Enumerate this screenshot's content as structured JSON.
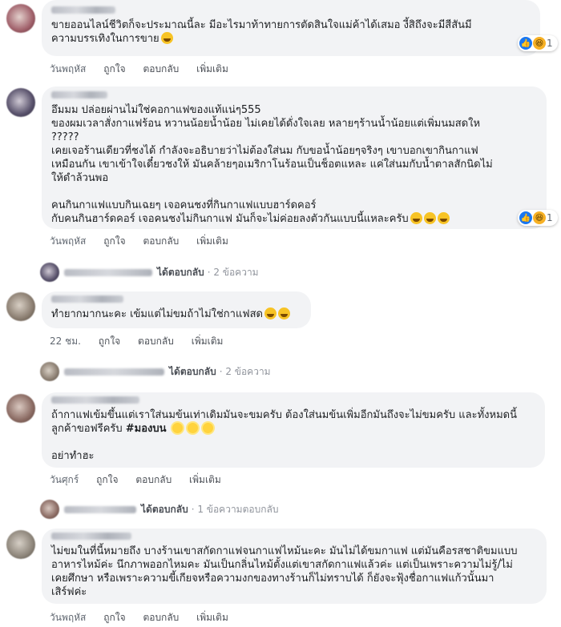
{
  "actions": {
    "day1": "วันพฤหัส",
    "day2": "วันพฤหัส",
    "day3": "22 ชม.",
    "day4": "วันศุกร์",
    "day5": "วันพฤหัส",
    "like": "ถูกใจ",
    "reply": "ตอบกลับ",
    "more": "เพิ่มเติม"
  },
  "reply_label": "ได้ตอบกลับ",
  "reply_count_2": "· 2 ข้อความ",
  "reply_count_1": "· 1 ข้อความตอบกลับ",
  "reactions": {
    "count_1": "1",
    "count_2": "1"
  },
  "comments": [
    {
      "lines": [
        "ขายออนไลน์ชีวิตก็จะประมาณนี้ละ มีอะไรมาท้าทายการตัดสินใจแม่ค้าได้เสมอ งี้สิถึงจะมีสีสันมี",
        "ความบรรเทิงในการขาย"
      ]
    },
    {
      "lines": [
        "อึมมม ปล่อยผ่านไม่ใช่คอกาแฟของแท้แน่ๆ555",
        " ของผมเวลาสั่งกาแฟร้อน หวานน้อยน้ำน้อย ไม่เคยได้ดั่งใจเลย หลายๆร้านน้ำน้อยแต่เพิ่มนมสดให",
        "?????",
        "เคยเจอร้านเดียวที่ชงได้ กำลังจะอธิบายว่าไม่ต้องใส่นม กับขอน้ำน้อยๆจริงๆ เขาบอกเขากินกาแฟ",
        "เหมือนกัน เขาเข้าใจเดี๋ยวชงให้ มันคล้ายๆอเมริกาโนร้อนเป็นช็อตแหละ แค่ใส่นมกับน้ำตาลสักนิดไม่",
        "ให้ดำล้วนพอ",
        "",
        "คนกินกาแฟแบบกินเฉยๆ เจอคนชงที่กินกาแฟแบบฮาร์ดคอร์",
        "กับคนกินฮาร์ดคอร์ เจอคนชงไม่กินกาแฟ มันก็จะไม่ค่อยลงตัวกันแบบนี้แหละครับ"
      ]
    },
    {
      "lines": [
        "ทำยากมากนะคะ เข้มแต่ไม่ขมถ้าไม่ใช่กาแฟสด"
      ]
    },
    {
      "lines": [
        "ถ้ากาแฟเข้มขึ้นแต่เราใส่นมข้นเท่าเดิมมันจะขมครับ ต้องใส่นมข้นเพิ่มอีกมันถึงจะไม่ขมครับ และทั้งหมดนี้",
        "ลูกค้าขอฟรีครับ "
      ],
      "hashtag": "#มองบน",
      "tail": "อย่าทำฮะ"
    },
    {
      "lines": [
        "ไม่ขมในที่นี้หมายถึง บางร้านเขาสกัดกาแฟจนกาแฟไหม้นะคะ มันไม่ได้ขมกาแฟ แต่มันคือรสชาติขมแบบ",
        "อาหารไหม้ค่ะ นึกภาพออกไหมคะ มันเป็นกลิ่นไหม้ตั้งแต่เขาสกัดกาแฟแล้วค่ะ แต่เป็นเพราะความไม่รู้/ไม่",
        "เคยศึกษา หรือเพราะความขี้เกียจหรือความงกของทางร้านก็ไม่ทราบได้ ก็ยังจะฟุ้งชื่อกาแฟแก้วนั้นมา",
        "เสิร์ฟค่ะ"
      ]
    }
  ]
}
